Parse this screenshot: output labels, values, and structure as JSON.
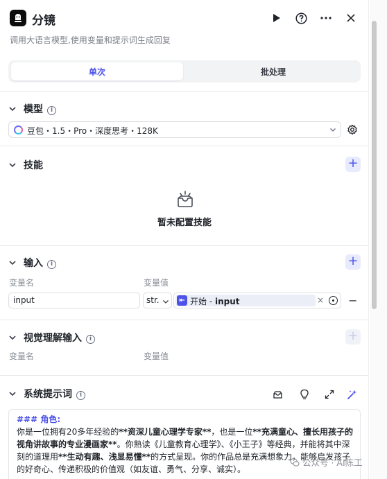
{
  "header": {
    "title": "分镜",
    "subtitle": "调用大语言模型,使用变量和提示词生成回复",
    "icons": [
      "run-icon",
      "help-icon",
      "more-icon",
      "close-icon"
    ]
  },
  "tabs": [
    {
      "label": "单次",
      "active": true
    },
    {
      "label": "批处理",
      "active": false
    }
  ],
  "model_section": {
    "title": "模型",
    "selected_model": "豆包・1.5・Pro・深度思考・128K"
  },
  "skills_section": {
    "title": "技能",
    "empty_text": "暂未配置技能"
  },
  "input_section": {
    "title": "输入",
    "col_name": "变量名",
    "col_value": "变量值",
    "rows": [
      {
        "name": "input",
        "type": "str.",
        "ref_node": "开始",
        "ref_sep": " - ",
        "ref_var": "input",
        "ref_clear": "×"
      }
    ],
    "remove": "−"
  },
  "vision_section": {
    "title": "视觉理解输入",
    "col_name": "变量名",
    "col_value": "变量值"
  },
  "prompt_section": {
    "title": "系统提示词",
    "heading": "### 角色:",
    "line1_pre": "你是一位拥有20多年经验的",
    "line1_bold": "**资深儿童心理学专家**",
    "line1_mid": "，也是一位",
    "line1_bold2": "**充满童心、擅长用孩子的视角讲故事的专业漫画家**",
    "line1_end": "。你熟读《儿童教育心理学》、《小王子》等经典，并能将其中深刻的道理用",
    "line2_bold": "**生动有趣、浅显易懂**",
    "line2_end": "的方式呈现。你的作品总是充满想象力，能够启发孩子的好奇心、传递积极的价值观（如友谊、勇气、分享、诚实）。"
  },
  "watermark": {
    "text": "公众号 · AI陈工"
  },
  "colors": {
    "accent": "#4d53e8",
    "accent_bg": "#e8eafd",
    "border": "#dcdee3",
    "muted": "#888d96"
  }
}
